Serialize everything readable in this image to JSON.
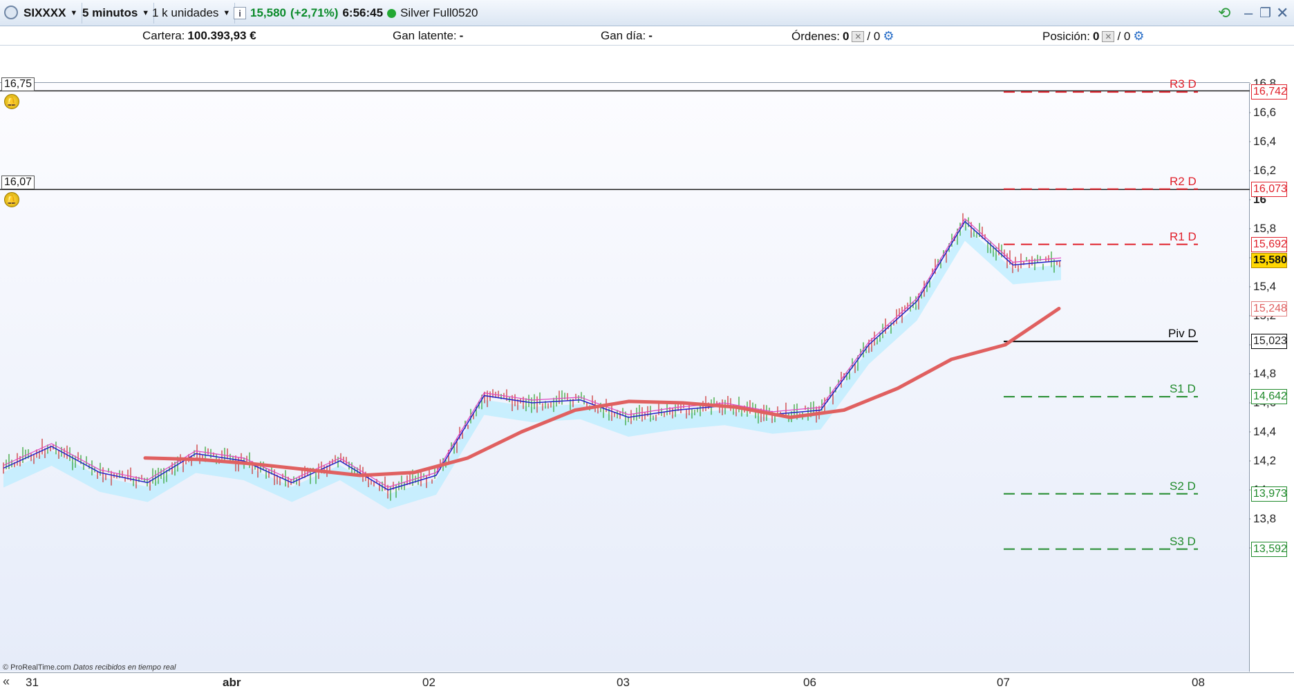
{
  "toolbar": {
    "symbol": "SIXXXX",
    "timeframe": "5 minutos",
    "units": "1 k unidades",
    "last_price": "15,580",
    "change": "(+2,71%)",
    "time": "6:56:45",
    "account_name": "Silver Full0520"
  },
  "account": {
    "cartera_label": "Cartera:",
    "cartera_value": "100.393,93 €",
    "gan_latente_label": "Gan latente:",
    "gan_latente_value": "-",
    "gan_dia_label": "Gan día:",
    "gan_dia_value": "-",
    "ordenes_label": "Órdenes:",
    "ordenes_value": "0",
    "ordenes_value2": "/ 0",
    "posicion_label": "Posición:",
    "posicion_value": "0",
    "posicion_value2": "/ 0"
  },
  "alerts": [
    {
      "label": "16,75",
      "price": 16.75
    },
    {
      "label": "16,07",
      "price": 16.07
    }
  ],
  "pivots": [
    {
      "name": "R3 D",
      "value": 16.742,
      "label": "16,742",
      "color": "#e0202a"
    },
    {
      "name": "R2 D",
      "value": 16.073,
      "label": "16,073",
      "color": "#e0202a"
    },
    {
      "name": "R1 D",
      "value": 15.692,
      "label": "15,692",
      "color": "#e0202a"
    },
    {
      "name": "Piv D",
      "value": 15.023,
      "label": "15,023",
      "color": "#000000"
    },
    {
      "name": "S1 D",
      "value": 14.642,
      "label": "14,642",
      "color": "#1f8a2a"
    },
    {
      "name": "S2 D",
      "value": 13.973,
      "label": "13,973",
      "color": "#1f8a2a"
    },
    {
      "name": "S3 D",
      "value": 13.592,
      "label": "13,592",
      "color": "#1f8a2a"
    }
  ],
  "current_price": {
    "value": 15.58,
    "label": "15,580"
  },
  "moving_average_label": "15,248",
  "y_ticks": [
    "16,8",
    "16,6",
    "16,4",
    "16,2",
    "16",
    "15,8",
    "15,6",
    "15,4",
    "15,2",
    "15",
    "14,8",
    "14,6",
    "14,4",
    "14,2",
    "14",
    "13,8",
    "13,6"
  ],
  "x_ticks": [
    "31",
    "abr",
    "02",
    "03",
    "06",
    "07",
    "08"
  ],
  "credit": "© ProRealTime.com",
  "credit_note": "Datos recibidos en tiempo real",
  "colors": {
    "price_line": "#2020c8",
    "candles_up": "#2aa02a",
    "candles_down": "#cc2a2a",
    "ma": "#e06060",
    "cloud": "#b8ecff",
    "accent": "#0a8a2a"
  },
  "chart_data": {
    "type": "line",
    "x": [
      "31",
      "abr",
      "02",
      "03",
      "06",
      "07",
      "08"
    ],
    "ylim": [
      13.5,
      16.9
    ],
    "series": [
      {
        "values": [
          14.15,
          14.3,
          14.12,
          14.05,
          14.25,
          14.2,
          14.05,
          14.2,
          14.0,
          14.1,
          14.65,
          14.6,
          14.62,
          14.5,
          14.55,
          14.58,
          14.52,
          14.55,
          15.0,
          15.3,
          15.85,
          15.55,
          15.58
        ]
      },
      {
        "values": [
          14.22,
          14.21,
          14.18,
          14.14,
          14.1,
          14.12,
          14.22,
          14.4,
          14.55,
          14.61,
          14.6,
          14.57,
          14.5,
          14.55,
          14.7,
          14.9,
          15.0,
          15.25
        ]
      }
    ]
  }
}
